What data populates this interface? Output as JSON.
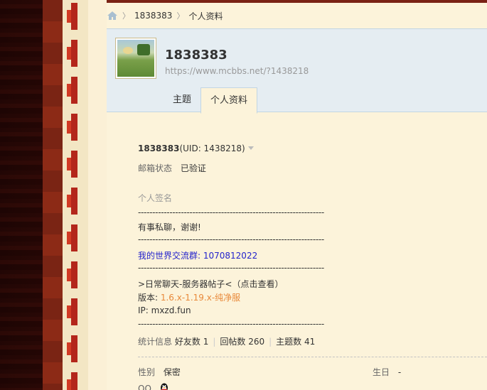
{
  "breadcrumb": {
    "icon": "home-icon",
    "items": [
      "1838383",
      "个人资料"
    ]
  },
  "profile": {
    "name": "1838383",
    "url": "https://www.mcbbs.net/?1438218"
  },
  "tabs": [
    {
      "label": "主题",
      "active": false
    },
    {
      "label": "个人资料",
      "active": true
    }
  ],
  "info": {
    "username": "1838383",
    "uid_text": "(UID: 1438218)",
    "email_label": "邮箱状态",
    "email_value": "已验证",
    "signature_label": "个人签名",
    "sig_dashes": "-----------------------------------------------------------------",
    "sig_line1": "有事私聊，谢谢!",
    "sig_group_label": "我的世界交流群: ",
    "sig_group_number": "1070812022",
    "sig_line3": ">日常聊天-服务器帖子<（点击查看）",
    "sig_version_label": "版本: ",
    "sig_version_value": "1.6.x-1.19.x-纯净服",
    "sig_ip": "IP: mxzd.fun",
    "stats_label": "统计信息",
    "friends_label": "好友数",
    "friends_value": "1",
    "replies_label": "回帖数",
    "replies_value": "260",
    "threads_label": "主题数",
    "threads_value": "41",
    "gender_label": "性别",
    "gender_value": "保密",
    "birthday_label": "生日",
    "birthday_value": "-",
    "qq_label": "QQ",
    "qq_icon": "qq-penguin-icon"
  },
  "colors": {
    "accent_blue": "#2222cc",
    "accent_orange": "#e8893a",
    "header_bg": "#e5edf2",
    "page_bg": "#fcf3da"
  }
}
